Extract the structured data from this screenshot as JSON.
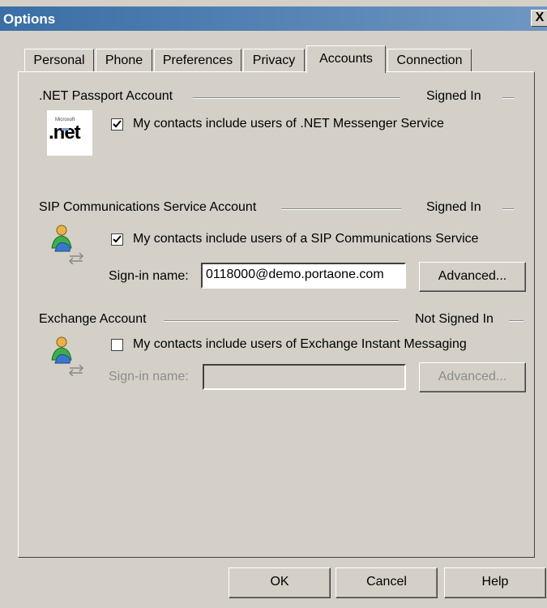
{
  "window": {
    "title": "Options",
    "close_label": "X"
  },
  "tabs": [
    {
      "label": "Personal",
      "active": false
    },
    {
      "label": "Phone",
      "active": false
    },
    {
      "label": "Preferences",
      "active": false
    },
    {
      "label": "Privacy",
      "active": false
    },
    {
      "label": "Accounts",
      "active": true
    },
    {
      "label": "Connection",
      "active": false
    }
  ],
  "net_passport": {
    "group_label": ".NET Passport Account",
    "status": "Signed In",
    "logo_small": "Microsoft",
    "logo_text": ".net",
    "checkbox_label": "My contacts include users of .NET Messenger Service",
    "checked": true
  },
  "sip": {
    "group_label": "SIP Communications Service Account",
    "status": "Signed In",
    "icon": "users-icon",
    "checkbox_label": "My contacts include users of a SIP Communications Service",
    "checked": true,
    "signin_label": "Sign-in name:",
    "signin_value": "0118000@demo.portaone.com",
    "advanced_label": "Advanced..."
  },
  "exchange": {
    "group_label": "Exchange Account",
    "status": "Not Signed In",
    "icon": "users-icon",
    "checkbox_label": "My contacts include users of Exchange Instant Messaging",
    "checked": false,
    "signin_label": "Sign-in name:",
    "signin_value": "",
    "advanced_label": "Advanced..."
  },
  "buttons": {
    "ok": "OK",
    "cancel": "Cancel",
    "help": "Help"
  }
}
